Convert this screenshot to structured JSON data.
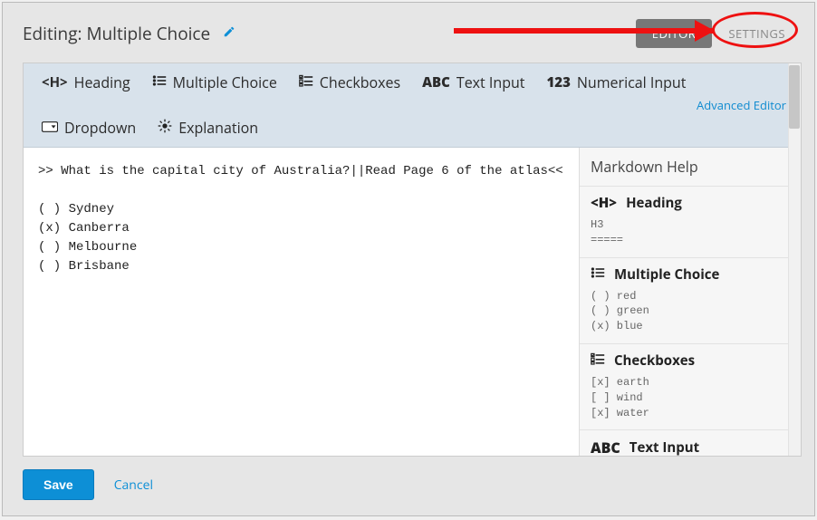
{
  "header": {
    "title": "Editing: Multiple Choice",
    "tabs": {
      "editor": "EDITOR",
      "settings": "SETTINGS"
    }
  },
  "toolbar": {
    "heading": "Heading",
    "multiple_choice": "Multiple Choice",
    "checkboxes": "Checkboxes",
    "text_input": "Text Input",
    "numerical_input": "Numerical Input",
    "dropdown": "Dropdown",
    "explanation": "Explanation",
    "advanced_editor": "Advanced Editor",
    "icons": {
      "heading": "<H>",
      "list": "list",
      "checkboxes": "checkboxes",
      "abc": "ABC",
      "n123": "123",
      "dropdown": "dropdown",
      "explanation": "sun"
    }
  },
  "editor_content": ">> What is the capital city of Australia?||Read Page 6 of the atlas<<\n\n( ) Sydney\n(x) Canberra\n( ) Melbourne\n( ) Brisbane",
  "help": {
    "title": "Markdown Help",
    "sections": [
      {
        "icon": "<H>",
        "title": "Heading",
        "example": "H3\n====="
      },
      {
        "icon": "list",
        "title": "Multiple Choice",
        "example": "( ) red\n( ) green\n(x) blue"
      },
      {
        "icon": "checkboxes",
        "title": "Checkboxes",
        "example": "[x] earth\n[ ] wind\n[x] water"
      },
      {
        "icon": "ABC",
        "title": "Text Input",
        "example": ""
      }
    ]
  },
  "footer": {
    "save": "Save",
    "cancel": "Cancel"
  },
  "annotation": {
    "target": "settings-tab"
  }
}
